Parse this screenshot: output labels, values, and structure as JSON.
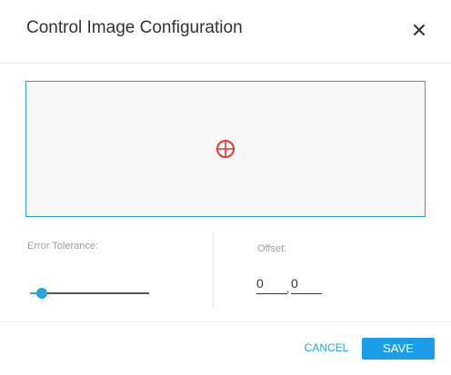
{
  "dialog": {
    "title": "Control Image Configuration",
    "close_icon": "close-icon"
  },
  "preview": {
    "marker_icon": "crosshair-icon",
    "marker_color": "#e53935",
    "border_color": "#29a3d8"
  },
  "error_tolerance": {
    "label": "Error Tolerance:",
    "value_fraction": 0.1
  },
  "offset": {
    "label": "Offset:",
    "x": "0",
    "y": "0",
    "separator": ","
  },
  "footer": {
    "cancel_label": "CANCEL",
    "save_label": "SAVE"
  },
  "colors": {
    "accent": "#29a3d8",
    "save_button": "#1a9ee8"
  }
}
